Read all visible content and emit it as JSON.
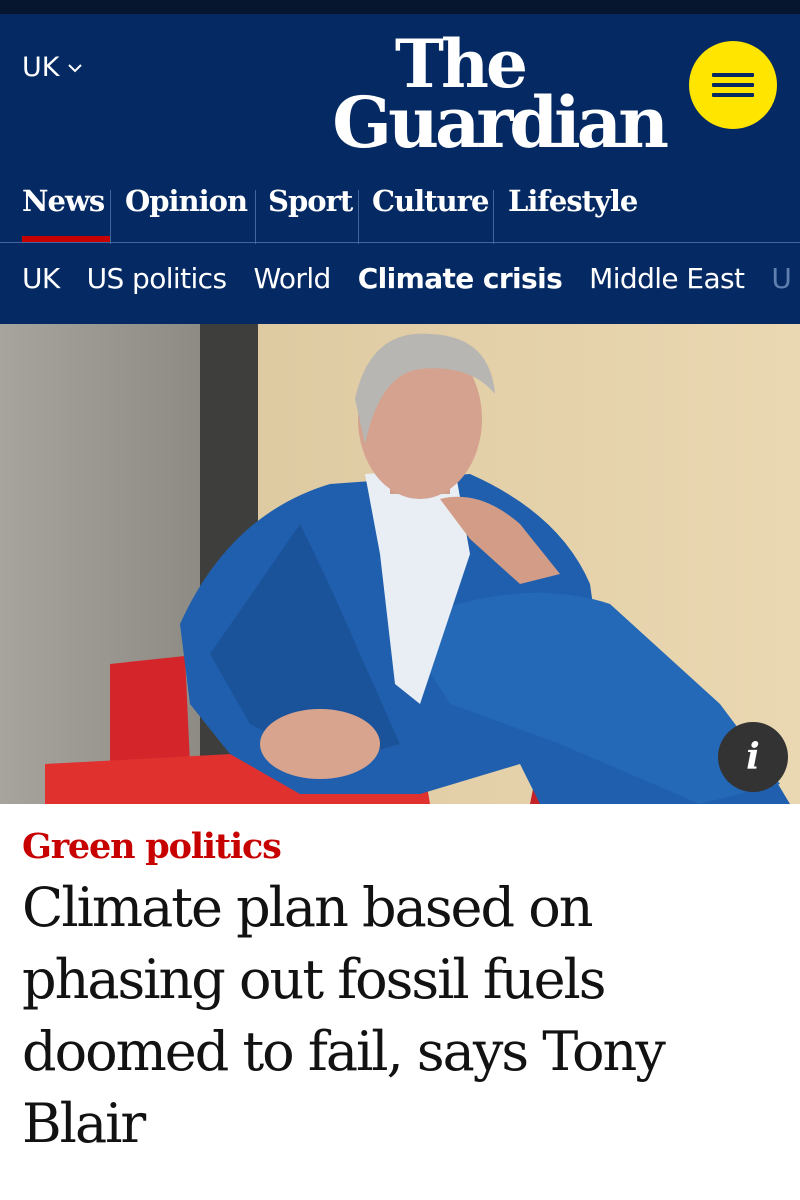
{
  "header": {
    "edition_label": "UK",
    "logo_line1": "The",
    "logo_line2": "Guardian",
    "brand_color": "#052962",
    "accent_color": "#ffe500",
    "menu_icon": "hamburger-menu-icon"
  },
  "pillars": [
    {
      "label": "News",
      "active": true
    },
    {
      "label": "Opinion"
    },
    {
      "label": "Sport"
    },
    {
      "label": "Culture"
    },
    {
      "label": "Lifestyle"
    }
  ],
  "subnav": [
    {
      "label": "UK"
    },
    {
      "label": "US politics"
    },
    {
      "label": "World"
    },
    {
      "label": "Climate crisis",
      "active": true
    },
    {
      "label": "Middle East"
    },
    {
      "label": "U"
    }
  ],
  "hero": {
    "info_icon": "info-icon",
    "info_label": "i"
  },
  "article": {
    "kicker": "Green politics",
    "kicker_color": "#c70000",
    "headline": "Climate plan based on phasing out fossil fuels doomed to fail, says Tony Blair"
  }
}
